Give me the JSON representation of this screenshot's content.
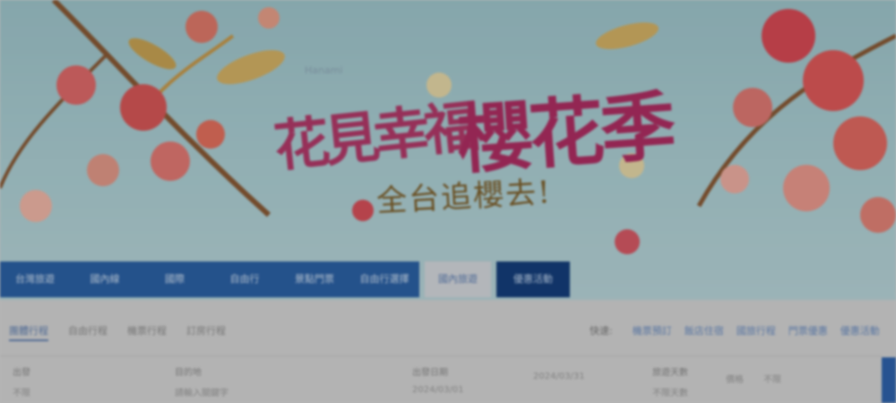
{
  "banner": {
    "subtitle_en": "Hanami",
    "title_small": "花見幸福",
    "title_big": "櫻花季",
    "subtitle": "全台追櫻去!"
  },
  "nav": {
    "items": [
      "台灣旅遊",
      "國內線",
      "國際",
      "自由行",
      "景點門票",
      "自由行選擇"
    ],
    "active": "國內旅遊",
    "button": "優惠活動"
  },
  "tabs": [
    "團體行程",
    "自由行程",
    "機票行程",
    "訂房行程"
  ],
  "quick_links": {
    "label": "快速:",
    "links": [
      "機票預訂",
      "飯店住宿",
      "國旅行程",
      "門票優惠",
      "優惠活動"
    ]
  },
  "fields": [
    {
      "label": "出發",
      "value": "不限"
    },
    {
      "label": "目的地",
      "value": "請輸入關鍵字"
    },
    {
      "label": "出發日期",
      "value": "2024/03/01"
    },
    {
      "label": "",
      "value": "2024/03/31"
    },
    {
      "label": "旅遊天數",
      "value": "不限天數"
    },
    {
      "label": "",
      "value": "價格"
    },
    {
      "label": "",
      "value": "不限"
    }
  ],
  "colors": {
    "nav_blue": "#2c62a6",
    "nav_dark": "#153f7c",
    "title_pink": "#b02e63",
    "sky": "#aed1d6"
  }
}
